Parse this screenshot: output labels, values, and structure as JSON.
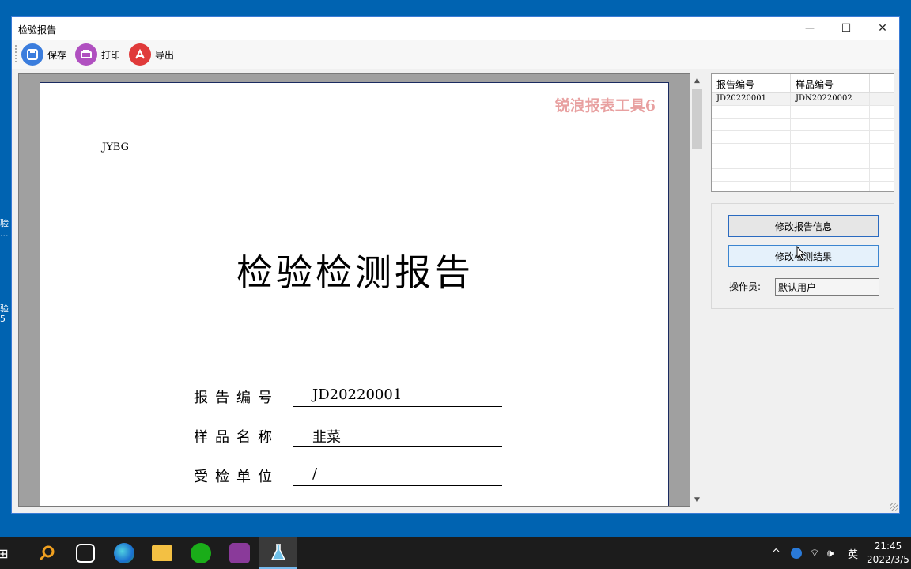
{
  "window": {
    "title": "检验报告",
    "controls": {
      "minimize": "—",
      "maximize": "☐",
      "close": "✕"
    }
  },
  "toolbar": {
    "buttons": [
      {
        "label": "保存",
        "icon": "save-icon",
        "color": "#3b7ddd"
      },
      {
        "label": "打印",
        "icon": "print-icon",
        "color": "#b050c0"
      },
      {
        "label": "导出",
        "icon": "pdf-export-icon",
        "color": "#e03a3a"
      }
    ]
  },
  "report": {
    "watermark": "锐浪报表工具6",
    "code": "JYBG",
    "title": "检验检测报告",
    "fields": [
      {
        "label": "报告编号",
        "value": "JD20220001"
      },
      {
        "label": "样品名称",
        "value": "韭菜"
      },
      {
        "label": "受检单位",
        "value": "/"
      }
    ]
  },
  "grid": {
    "columns": [
      "报告编号",
      "样品编号"
    ],
    "rows": [
      [
        "JD20220001",
        "JDN20220002"
      ]
    ]
  },
  "actions": {
    "edit_report": "修改报告信息",
    "edit_results": "修改检测结果",
    "operator_label": "操作员:",
    "operator_value": "默认用户"
  },
  "desktop": {
    "fragment1": "验\n...",
    "fragment2": "验\n5"
  },
  "taskbar": {
    "apps": [
      "start-icon",
      "search-icon",
      "widget-icon",
      "edge-icon",
      "file-explorer-icon",
      "wechat-icon",
      "video-app-icon",
      "flask-app-icon"
    ],
    "tray_language": "英",
    "time": "21:45",
    "date": "2022/3/5"
  }
}
